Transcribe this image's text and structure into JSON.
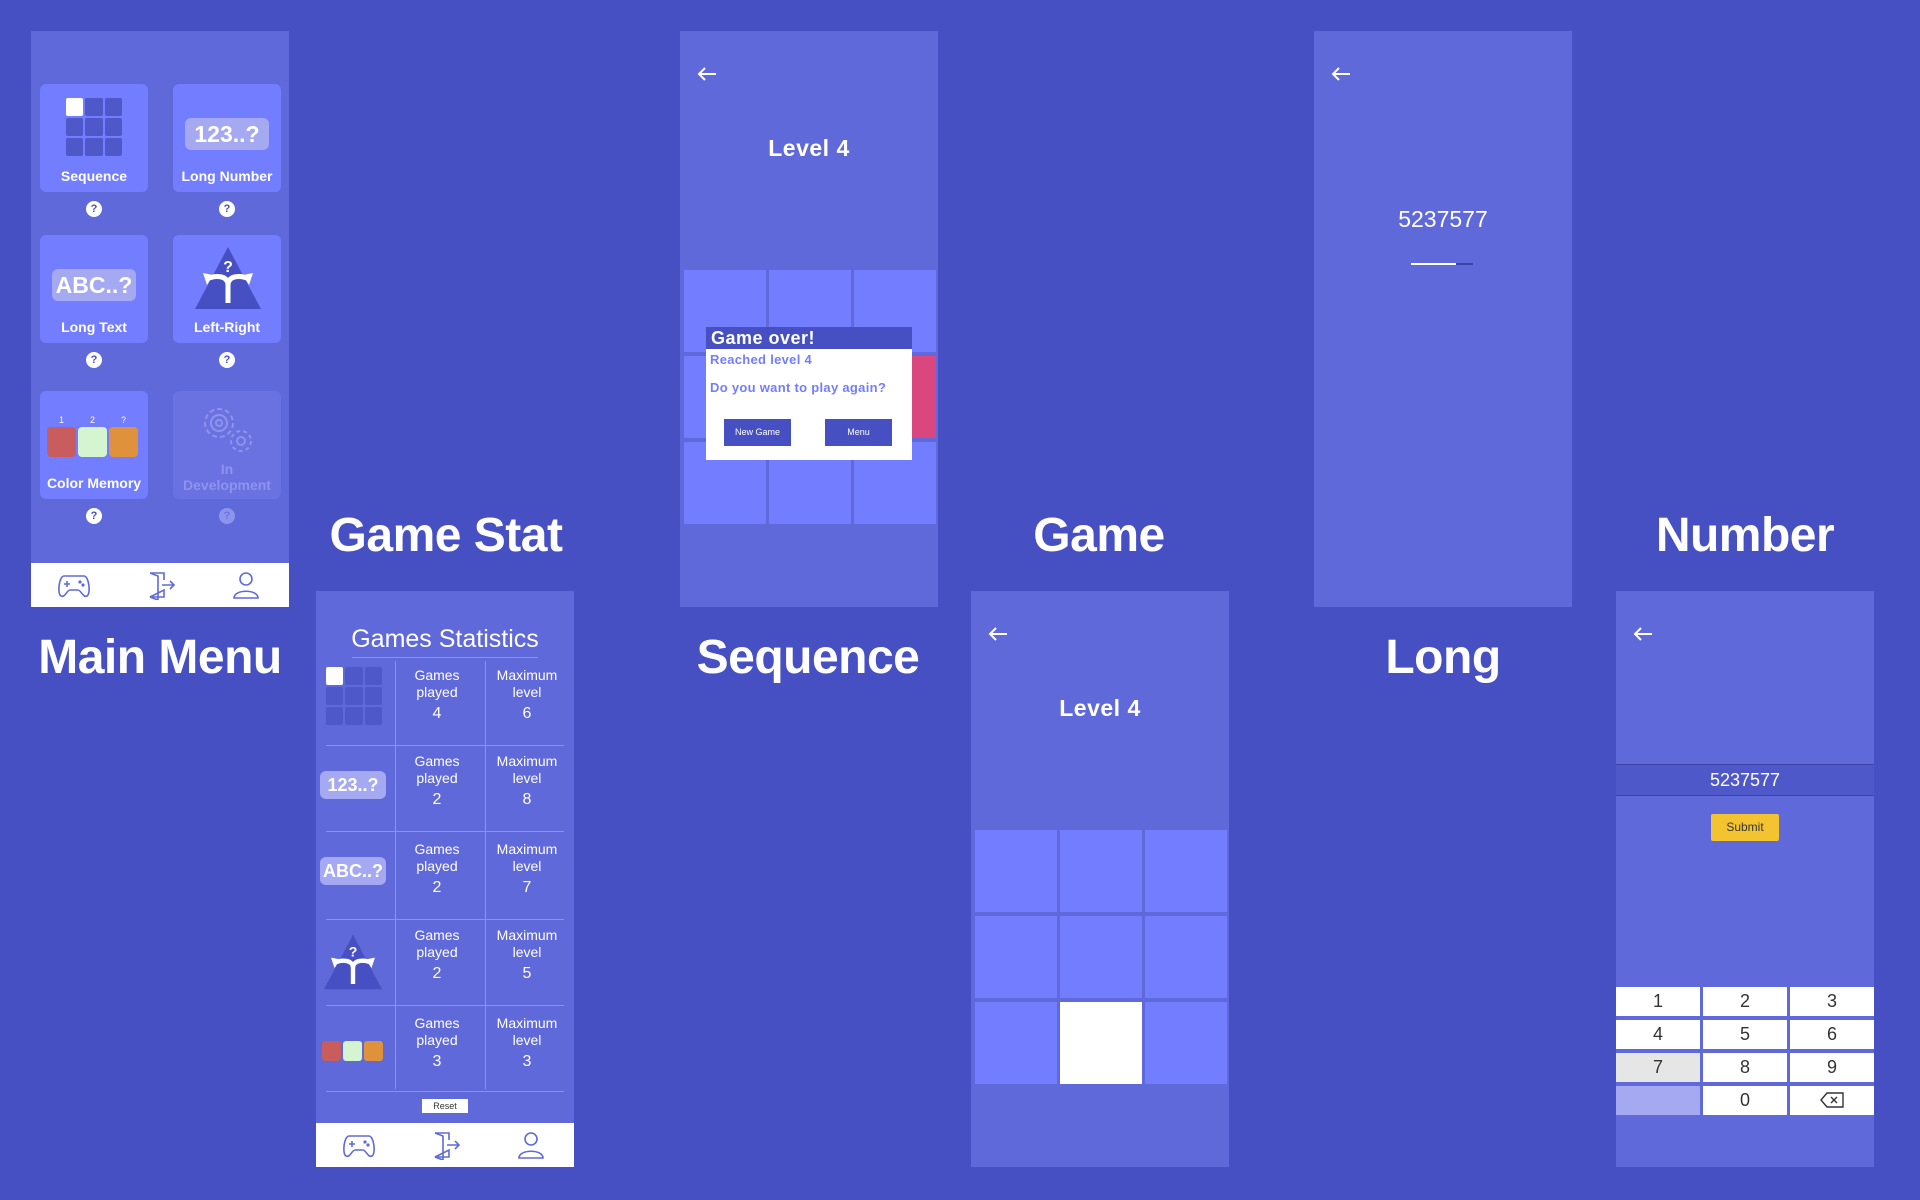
{
  "captions": {
    "main_menu": "Main Menu",
    "game_stat": "Game Stat",
    "sequence": "Sequence",
    "game": "Game",
    "long": "Long",
    "number": "Number"
  },
  "main_menu": {
    "tiles": [
      {
        "label": "Sequence",
        "icon": "sequence-grid-icon"
      },
      {
        "label": "Long Number",
        "badge": "123..?"
      },
      {
        "label": "Long Text",
        "badge": "ABC..?"
      },
      {
        "label": "Left-Right",
        "icon": "left-right-arrows-icon"
      },
      {
        "label": "Color Memory",
        "icon": "color-memory-icon",
        "digits": [
          "1",
          "2",
          "?"
        ]
      },
      {
        "label_line1": "In",
        "label_line2": "Development",
        "icon": "gears-icon"
      }
    ],
    "help": "?"
  },
  "stats": {
    "title": "Games Statistics",
    "col_played_line1": "Games",
    "col_played_line2": "played",
    "col_max_line1": "Maximum",
    "col_max_line2": "level",
    "rows": [
      {
        "game": "Sequence",
        "played": "4",
        "max": "6"
      },
      {
        "game": "Long Number",
        "played": "2",
        "max": "8",
        "badge": "123..?"
      },
      {
        "game": "Long Text",
        "played": "2",
        "max": "7",
        "badge": "ABC..?"
      },
      {
        "game": "Left-Right",
        "played": "2",
        "max": "5"
      },
      {
        "game": "Color Memory",
        "played": "3",
        "max": "3"
      }
    ],
    "reset": "Reset"
  },
  "sequence": {
    "level": "Level 4",
    "dialog": {
      "title": "Game over!",
      "reached": "Reached level 4",
      "question": "Do you want to play again?",
      "new_game": "New Game",
      "menu": "Menu"
    }
  },
  "game": {
    "level": "Level 4"
  },
  "long": {
    "number": "5237577"
  },
  "number": {
    "input": "5237577",
    "submit": "Submit",
    "keys": [
      "1",
      "2",
      "3",
      "4",
      "5",
      "6",
      "7",
      "8",
      "9",
      "0"
    ]
  },
  "colors": {
    "background": "#4650c2",
    "panel": "#6069d9",
    "tile": "#737dff",
    "accent_pink": "#d9477e",
    "submit": "#f4c430"
  }
}
